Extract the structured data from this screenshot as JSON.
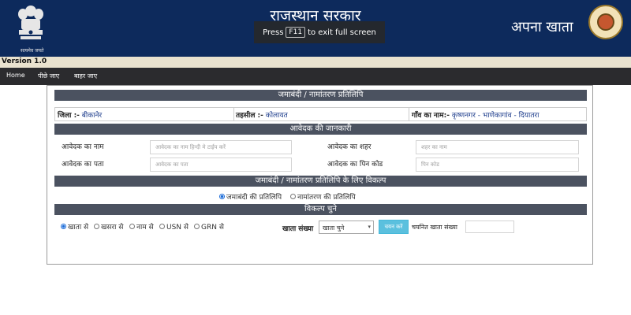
{
  "header": {
    "title": "राजस्थान सरकार",
    "right_title": "अपना खाता",
    "emblem_caption": "सत्यमेव जयते",
    "fullscreen_notice": {
      "prefix": "Press",
      "key": "F11",
      "suffix": "to exit full screen"
    }
  },
  "version": "Version 1.0",
  "nav": {
    "items": [
      {
        "label": "Home"
      },
      {
        "label": "पीछे जाए"
      },
      {
        "label": "बाहर जाए"
      }
    ]
  },
  "sections": {
    "jamabandi": "जमाबंदी / नामांतरण प्रतिलिपि",
    "applicant_info": "आवेदक की जानकारी",
    "options": "जमाबंदी / नामांतरण प्रतिलिपि के लिए विकल्प",
    "choose_option": "विकल्प चुने"
  },
  "location": {
    "district_label": "जिला :-",
    "district_value": "बीकानेर",
    "tehsil_label": "तहसील :-",
    "tehsil_value": "कोलायत",
    "village_label": "गाँव का नाम:-",
    "village_value": "कृष्णनगर - भाणेकागांव - दियातरा"
  },
  "applicant": {
    "name_label": "आवेदक का नाम",
    "name_placeholder": "आवेदक का नाम हिन्दी मे टाईप करें",
    "city_label": "आवेदक का शहर",
    "city_placeholder": "शहर का नाम",
    "address_label": "आवेदक का पता",
    "address_placeholder": "आवेदक का पता",
    "pincode_label": "आवेदक का पिन कोड",
    "pincode_placeholder": "पिन कोड"
  },
  "copy_type": {
    "options": [
      "जमाबंदी की प्रतिलिपि",
      "नामांतरण की प्रतिलिपि"
    ],
    "selected": "जमाबंदी की प्रतिलिपि"
  },
  "search_by": {
    "options": [
      "खाता से",
      "खसरा से",
      "नाम से",
      "USN से",
      "GRN से"
    ],
    "selected": "खाता से"
  },
  "khata": {
    "label": "खाता संख्या",
    "select_value": "खाता चुने",
    "button_label": "चयन करें",
    "chosen_label": "चयनित खाता संख्या"
  },
  "colors": {
    "header_bg": "#0d2a5c",
    "nav_bg": "#2b2b2e",
    "section_bar": "#4b5260",
    "button": "#5bc0de"
  }
}
